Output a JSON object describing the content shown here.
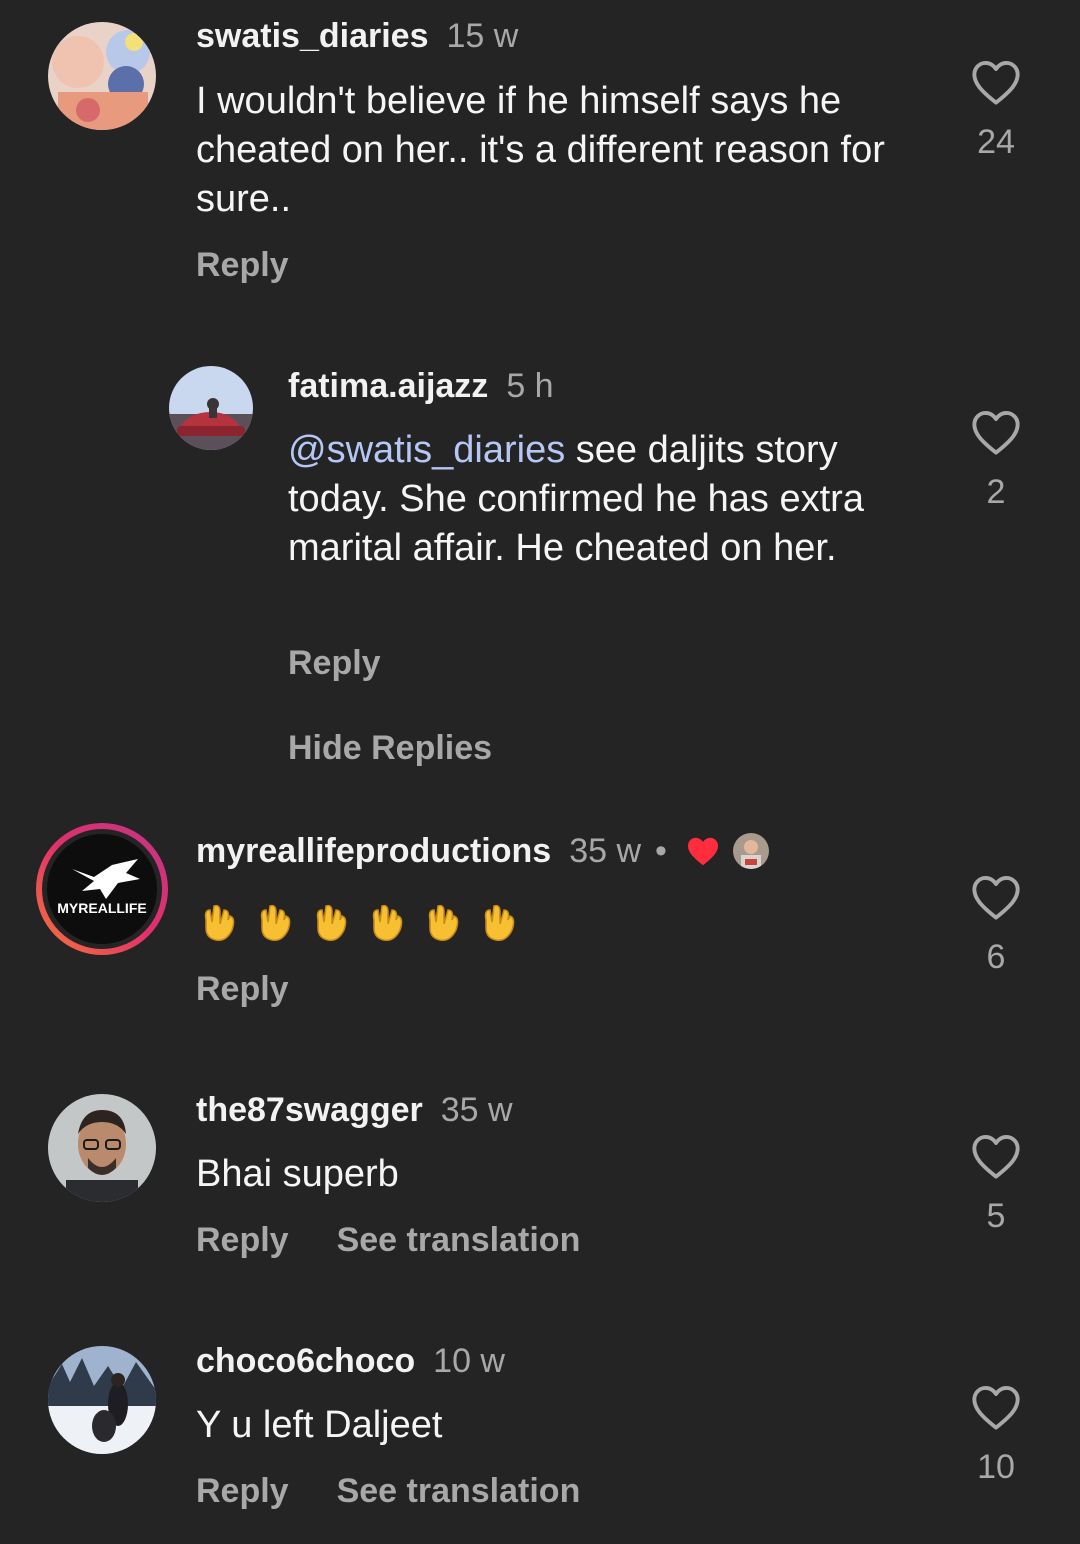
{
  "comments": [
    {
      "username": "swatis_diaries",
      "time": "15 w",
      "text": "I wouldn't believe if he himself says he cheated on her.. it's a different reason for sure..",
      "reply_label": "Reply",
      "likes": "24",
      "avatar_icon": "krishna-painting-avatar"
    },
    {
      "username": "fatima.aijazz",
      "time": "5 h",
      "mention": "@swatis_diaries",
      "text": " see daljits story today. She confirmed he has extra marital affair. He cheated on her.",
      "reply_label": "Reply",
      "likes": "2",
      "avatar_icon": "car-sky-avatar"
    },
    {
      "username": "myreallifeproductions",
      "time": "35 w",
      "emoji_text": "👏👏👏👏👏👏",
      "reply_label": "Reply",
      "likes": "6",
      "avatar_icon": "myreallife-logo-avatar",
      "creator_liked_icon": "red-heart-icon"
    },
    {
      "username": "the87swagger",
      "time": "35 w",
      "text": "Bhai superb",
      "reply_label": "Reply",
      "translate_label": "See translation",
      "likes": "5",
      "avatar_icon": "man-glasses-avatar"
    },
    {
      "username": "choco6choco",
      "time": "10 w",
      "text": "Y u left Daljeet",
      "reply_label": "Reply",
      "translate_label": "See translation",
      "likes": "10",
      "avatar_icon": "snow-landscape-avatar"
    }
  ],
  "hide_replies_label": "Hide Replies",
  "logo_text": "MYREALLIFE",
  "colors": {
    "background": "#242425",
    "muted": "#a8a8a8",
    "mention": "#b4c7f5",
    "heart_red": "#ff2d3d",
    "story_ring_start": "#e1306c",
    "story_ring_end": "#f77737"
  }
}
